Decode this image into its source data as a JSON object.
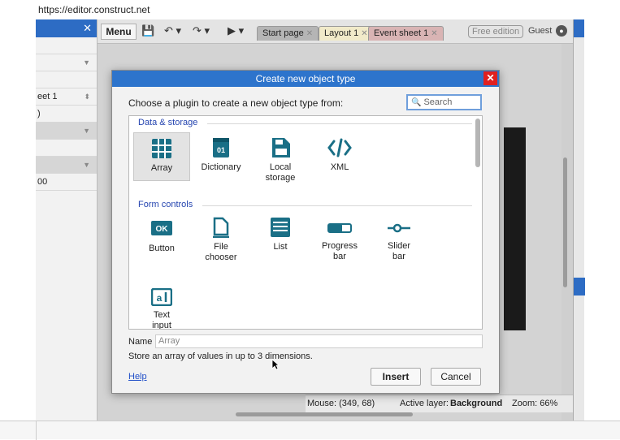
{
  "browser": {
    "url": "https://editor.construct.net"
  },
  "left_panel": {
    "rows": [
      {
        "text": ""
      },
      {
        "text": "",
        "arrow": "▼"
      },
      {
        "text": ""
      },
      {
        "text": "eet 1",
        "arrow": "⬍"
      },
      {
        "text": ")"
      },
      {
        "text": "",
        "arrow": "▼"
      },
      {
        "text": ""
      },
      {
        "text": "",
        "arrow": "▼"
      },
      {
        "text": "00"
      }
    ]
  },
  "toolbar": {
    "menu_label": "Menu",
    "save_icon": "💾",
    "undo_icon": "↶ ▾",
    "redo_icon": "↷ ▾",
    "play_icon": "▶ ▾",
    "tabs": [
      {
        "label": "Start page",
        "close": "✕"
      },
      {
        "label": "Layout 1",
        "close": "✕"
      },
      {
        "label": "Event sheet 1",
        "close": "✕"
      }
    ],
    "edition_badge": "Free edition",
    "user_name": "Guest"
  },
  "status_bar": {
    "mouse": "Mouse: (349, 68)",
    "active_layer_label": "Active layer:",
    "active_layer_value": "Background",
    "zoom": "Zoom: 66%"
  },
  "dialog": {
    "title": "Create new object type",
    "close_label": "✕",
    "prompt": "Choose a plugin to create a new object type from:",
    "search_placeholder": "Search",
    "categories": [
      {
        "label": "Data & storage",
        "plugins": [
          {
            "label": "Array",
            "icon": "grid-icon",
            "selected": true
          },
          {
            "label": "Dictionary",
            "icon": "dictionary-icon"
          },
          {
            "label": "Local storage",
            "icon": "floppy-icon"
          },
          {
            "label": "XML",
            "icon": "code-icon"
          }
        ]
      },
      {
        "label": "Form controls",
        "plugins": [
          {
            "label": "Button",
            "icon": "ok-button-icon"
          },
          {
            "label": "File chooser",
            "icon": "file-icon"
          },
          {
            "label": "List",
            "icon": "list-icon"
          },
          {
            "label": "Progress bar",
            "icon": "progress-bar-icon"
          },
          {
            "label": "Slider bar",
            "icon": "slider-icon"
          },
          {
            "label": "Text input",
            "icon": "text-input-icon"
          }
        ]
      }
    ],
    "name_label": "Name",
    "name_placeholder": "Array",
    "description": "Store an array of values in up to 3 dimensions.",
    "help_label": "Help",
    "insert_label": "Insert",
    "cancel_label": "Cancel"
  },
  "colors": {
    "accent_blue": "#2d74cc",
    "icon_teal": "#1a6f86",
    "category_blue": "#2545b0",
    "close_red": "#e02020"
  }
}
